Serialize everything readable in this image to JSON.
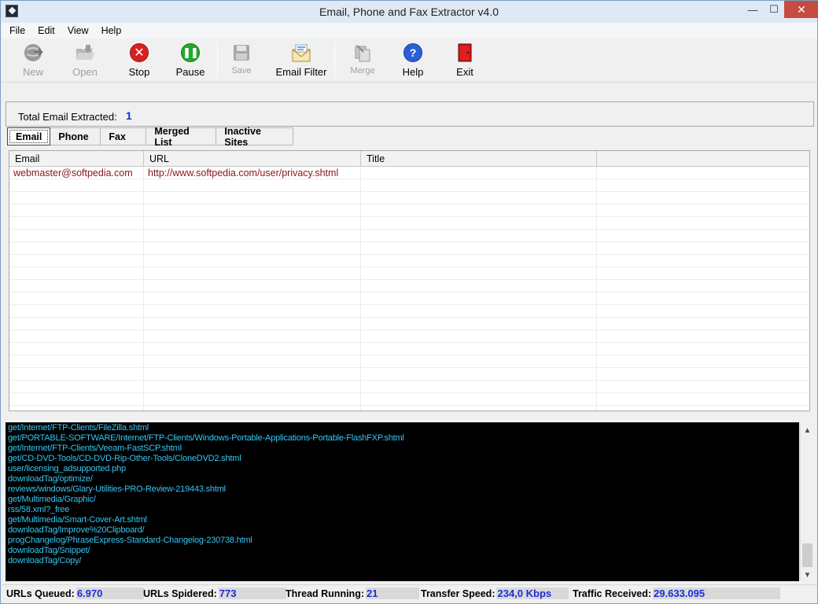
{
  "window": {
    "title": "Email, Phone and Fax Extractor v4.0",
    "minimize": "—",
    "maximize": "☐",
    "close": "✕"
  },
  "menu": [
    "File",
    "Edit",
    "View",
    "Help"
  ],
  "toolbar": {
    "new": "New",
    "open": "Open",
    "stop": "Stop",
    "pause": "Pause",
    "save": "Save",
    "email_filter": "Email Filter",
    "merge": "Merge",
    "help": "Help",
    "exit": "Exit"
  },
  "summary": {
    "label": "Total Email Extracted:",
    "value": "1"
  },
  "tabs": [
    "Email",
    "Phone",
    "Fax",
    "Merged List",
    "Inactive Sites"
  ],
  "grid": {
    "columns": [
      "Email",
      "URL",
      "Title",
      ""
    ],
    "rows": [
      {
        "email": "webmaster@softpedia.com",
        "url": "http://www.softpedia.com/user/privacy.shtml",
        "title": ""
      }
    ]
  },
  "log": [
    "get/Internet/FTP-Clients/FileZilla.shtml",
    "get/PORTABLE-SOFTWARE/Internet/FTP-Clients/Windows-Portable-Applications-Portable-FlashFXP.shtml",
    "get/Internet/FTP-Clients/Veeam-FastSCP.shtml",
    "get/CD-DVD-Tools/CD-DVD-Rip-Other-Tools/CloneDVD2.shtml",
    "user/licensing_adsupported.php",
    "downloadTag/optimize/",
    "reviews/windows/Glary-Utilities-PRO-Review-219443.shtml",
    "get/Multimedia/Graphic/",
    "rss/58.xml?_free",
    "get/Multimedia/Smart-Cover-Art.shtml",
    "downloadTag/Improve%20Clipboard/",
    "progChangelog/PhraseExpress-Standard-Changelog-230738.html",
    "downloadTag/Snippet/",
    "downloadTag/Copy/"
  ],
  "status": {
    "urls_queued_label": "URLs Queued:",
    "urls_queued": "6.970",
    "urls_spidered_label": "URLs Spidered:",
    "urls_spidered": "773",
    "thread_running_label": "Thread Running:",
    "thread_running": "21",
    "transfer_speed_label": "Transfer Speed:",
    "transfer_speed": "234,0 Kbps",
    "traffic_received_label": "Traffic Received:",
    "traffic_received": "29.633.095"
  },
  "icons": {
    "new": "globe-icon",
    "open": "folder-icon",
    "stop": "stop-icon",
    "pause": "pause-icon",
    "save": "floppy-icon",
    "email_filter": "envelope-icon",
    "merge": "merge-icon",
    "help": "question-icon",
    "exit": "door-icon"
  },
  "colors": {
    "log_text": "#35c6f2",
    "value_blue": "#1a2cd8",
    "grid_text": "#8b1414",
    "stop_red": "#d82020",
    "pause_green": "#25a82a"
  }
}
